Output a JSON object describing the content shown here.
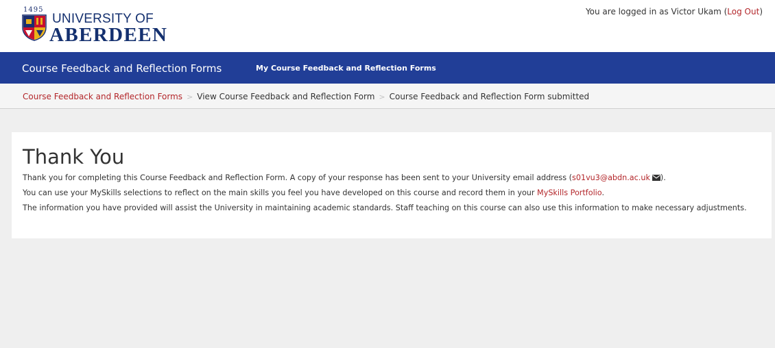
{
  "header": {
    "logo_year": "1495",
    "logo_line1": "UNIVERSITY OF",
    "logo_line2": "ABERDEEN",
    "login_prefix": "You are logged in as Victor Ukam (",
    "logout_label": "Log Out",
    "login_suffix": ")"
  },
  "navbar": {
    "brand": "Course Feedback and Reflection Forms",
    "link": "My Course Feedback and Reflection Forms",
    "background_color": "#213e97"
  },
  "breadcrumb": {
    "items": [
      "Course Feedback and Reflection Forms",
      "View Course Feedback and Reflection Form",
      "Course Feedback and Reflection Form submitted"
    ],
    "separator": ">"
  },
  "content": {
    "title": "Thank You",
    "p1_text": "Thank you for completing this Course Feedback and Reflection Form. A copy of your response has been sent to your University email address (",
    "p1_email": "s01vu3@abdn.ac.uk",
    "p1_end": ").",
    "p2_text": "You can use your MySkills selections to reflect on the main skills you feel you have developed on this course and record them in your ",
    "p2_link": "MySkills Portfolio",
    "p2_end": ".",
    "p3_text": "The information you have provided will assist the University in maintaining academic standards. Staff teaching on this course can also use this information to make necessary adjustments."
  },
  "icons": {
    "email": "envelope-icon",
    "crest": "university-crest-icon"
  },
  "colors": {
    "link": "#b3262a",
    "brand_blue": "#14306f"
  }
}
